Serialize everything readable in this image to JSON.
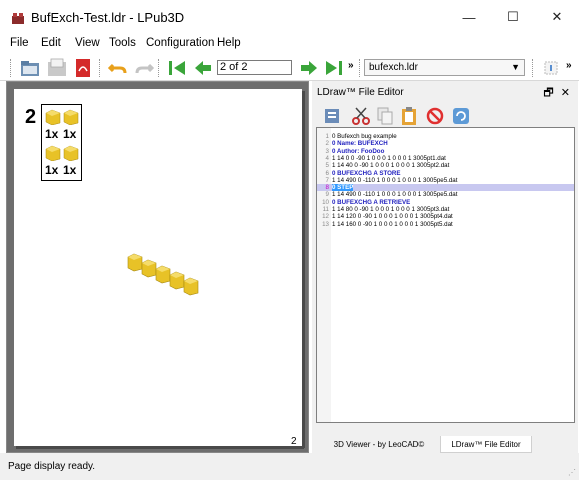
{
  "window": {
    "title": "BufExch-Test.ldr - LPub3D",
    "minimize": "—",
    "maximize": "☐",
    "close": "✕"
  },
  "menu": [
    "File",
    "Edit",
    "View",
    "Tools",
    "Configuration",
    "Help"
  ],
  "toolbar": {
    "page_field": "2 of 2",
    "file_combo": "bufexch.ldr",
    "chevron": "»"
  },
  "page": {
    "step_number": "2",
    "pli_qty_1": "1x",
    "pli_qty_2": "1x",
    "pli_qty_3": "1x",
    "pli_qty_4": "1x",
    "page_number": "2"
  },
  "editor": {
    "dock_title": "LDraw™ File Editor",
    "dock_float": "🗗",
    "dock_close": "✕",
    "lines": [
      {
        "n": "1",
        "text": "0 Bufexch bug example",
        "kw": false
      },
      {
        "n": "2",
        "text": "0 Name: BUFEXCH",
        "kw": true
      },
      {
        "n": "3",
        "text": "0 Author: FooDoo",
        "kw": true
      },
      {
        "n": "4",
        "text": "1 14 0 0 -90 1 0 0 0 1 0 0 0 1 3005pt1.dat",
        "kw": false
      },
      {
        "n": "5",
        "text": "1 14 40 0 -90 1 0 0 0 1 0 0 0 1 3005pt2.dat",
        "kw": false
      },
      {
        "n": "6",
        "text": "0 BUFEXCHG A STORE",
        "kw": true
      },
      {
        "n": "7",
        "text": "1 14 490 0 -110 1 0 0 0 1 0 0 0 1 3005pe5.dat",
        "kw": false
      },
      {
        "n": "8",
        "text": "0 STEP",
        "kw": true
      },
      {
        "n": "9",
        "text": "1 14 490 0 -110 1 0 0 0 1 0 0 0 1 3005pe5.dat",
        "kw": false
      },
      {
        "n": "10",
        "text": "0 BUFEXCHG A RETRIEVE",
        "kw": true
      },
      {
        "n": "11",
        "text": "1 14 80 0 -90 1 0 0 0 1 0 0 0 1 3005pt3.dat",
        "kw": false
      },
      {
        "n": "12",
        "text": "1 14 120 0 -90 1 0 0 0 1 0 0 0 1 3005pt4.dat",
        "kw": false
      },
      {
        "n": "13",
        "text": "1 14 160 0 -90 1 0 0 0 1 0 0 0 1 3005pt5.dat",
        "kw": false
      }
    ]
  },
  "tabs": {
    "viewer": "3D Viewer - by LeoCAD©",
    "editor": "LDraw™ File Editor"
  },
  "status": {
    "text": "Page display ready."
  },
  "colors": {
    "brick_yellow": "#e8c227",
    "keyword_blue": "#1e1ebe",
    "nav_green": "#3aa53a",
    "current_line": "#c8c8f0"
  }
}
